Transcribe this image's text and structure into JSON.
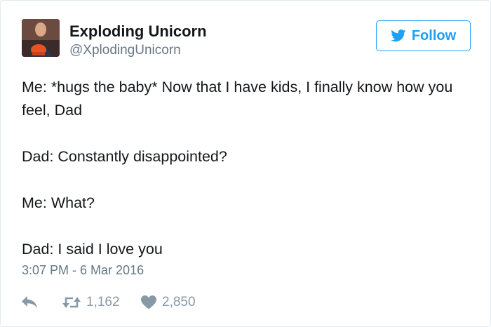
{
  "user": {
    "name": "Exploding Unicorn",
    "handle": "@XplodingUnicorn"
  },
  "follow_label": "Follow",
  "tweet": {
    "lines": [
      "Me: *hugs the baby* Now that I have kids, I finally know how you feel, Dad",
      "Dad: Constantly disappointed?",
      "Me: What?",
      "Dad: I said I love you"
    ],
    "timestamp": "3:07 PM - 6 Mar 2016"
  },
  "stats": {
    "retweets": "1,162",
    "likes": "2,850"
  },
  "colors": {
    "accent": "#1da1f2",
    "muted": "#657786",
    "icon": "#8899a6"
  },
  "icons": [
    "twitter-bird-icon",
    "reply-icon",
    "retweet-icon",
    "heart-icon"
  ]
}
